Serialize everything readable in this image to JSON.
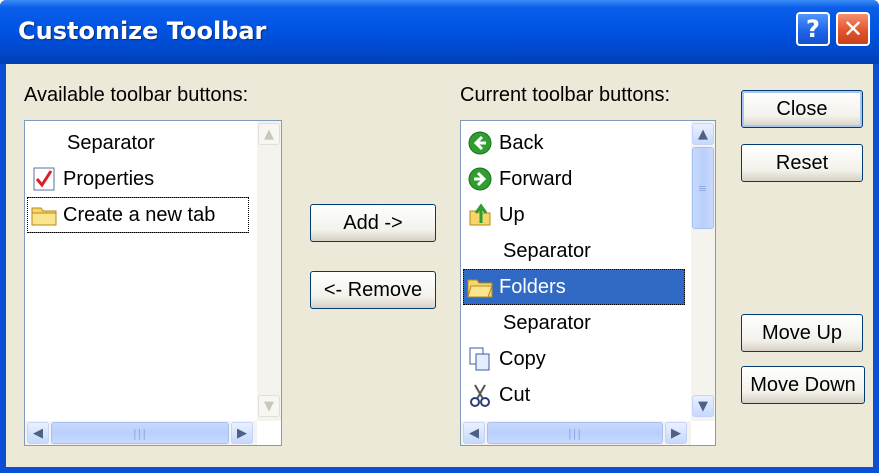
{
  "window": {
    "title": "Customize Toolbar"
  },
  "available": {
    "label": "Available toolbar buttons:",
    "items": [
      {
        "label": "Separator",
        "icon": ""
      },
      {
        "label": "Properties",
        "icon": "properties-icon"
      },
      {
        "label": "Create a new tab",
        "icon": "folder-icon"
      }
    ]
  },
  "current": {
    "label": "Current toolbar buttons:",
    "items": [
      {
        "label": "Back",
        "icon": "back-arrow-icon"
      },
      {
        "label": "Forward",
        "icon": "forward-arrow-icon"
      },
      {
        "label": "Up",
        "icon": "up-folder-icon"
      },
      {
        "label": "Separator",
        "icon": ""
      },
      {
        "label": "Folders",
        "icon": "folders-icon"
      },
      {
        "label": "Separator",
        "icon": ""
      },
      {
        "label": "Copy",
        "icon": "copy-icon"
      },
      {
        "label": "Cut",
        "icon": "cut-icon"
      }
    ],
    "selected_label": "Folders"
  },
  "buttons": {
    "add": "Add ->",
    "remove": "<- Remove",
    "close": "Close",
    "reset": "Reset",
    "move_up": "Move Up",
    "move_down": "Move Down"
  },
  "title_buttons": {
    "help": "?",
    "close": "✕"
  },
  "colors": {
    "titlebar": "#0054e3",
    "selection": "#316ac5",
    "dialog_bg": "#ece9d8"
  }
}
